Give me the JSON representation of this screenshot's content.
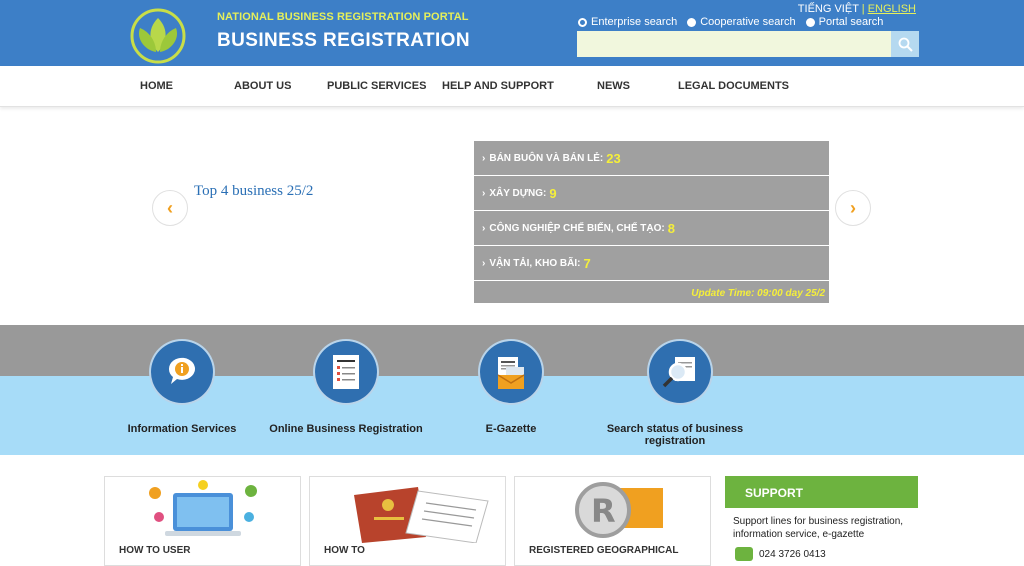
{
  "header": {
    "portal_name": "NATIONAL BUSINESS REGISTRATION PORTAL",
    "site_title": "BUSINESS REGISTRATION",
    "lang_vi": "TIẾNG VIỆT",
    "lang_sep": "|",
    "lang_en": "ENGLISH",
    "search_options": [
      "Enterprise search",
      "Cooperative search",
      "Portal search"
    ],
    "search_value": "",
    "colors": {
      "header_bg": "#3d7fc7",
      "accent_yellow": "#e5ef5b"
    }
  },
  "nav": {
    "items": [
      "HOME",
      "ABOUT US",
      "PUBLIC SERVICES",
      "HELP AND SUPPORT",
      "NEWS",
      "LEGAL DOCUMENTS"
    ]
  },
  "slider": {
    "title": "Top 4 business 25/2",
    "prev_icon": "chevron-left-icon",
    "next_icon": "chevron-right-icon",
    "rows": [
      {
        "label": "BÁN BUÔN VÀ BÁN LẺ:",
        "value": "23"
      },
      {
        "label": "XÂY DỰNG:",
        "value": "9"
      },
      {
        "label": "CÔNG NGHIỆP CHẾ BIẾN, CHẾ TẠO:",
        "value": "8"
      },
      {
        "label": "VẬN TẢI, KHO BÃI:",
        "value": "7"
      }
    ],
    "update_time": "Update Time: 09:00 day 25/2"
  },
  "services": [
    {
      "label": "Information Services",
      "icon": "info-bubble-icon"
    },
    {
      "label": "Online Business Registration",
      "icon": "registration-form-icon"
    },
    {
      "label": "E-Gazette",
      "icon": "newspaper-envelope-icon"
    },
    {
      "label": "Search status of business registration",
      "icon": "magnifier-document-icon"
    }
  ],
  "cards": [
    {
      "label": "HOW TO USER"
    },
    {
      "label": "HOW TO"
    },
    {
      "label": "REGISTERED GEOGRAPHICAL"
    }
  ],
  "support": {
    "heading": "SUPPORT",
    "text": "Support lines for business registration, information service, e-gazette",
    "phone": "024 3726 0413"
  }
}
